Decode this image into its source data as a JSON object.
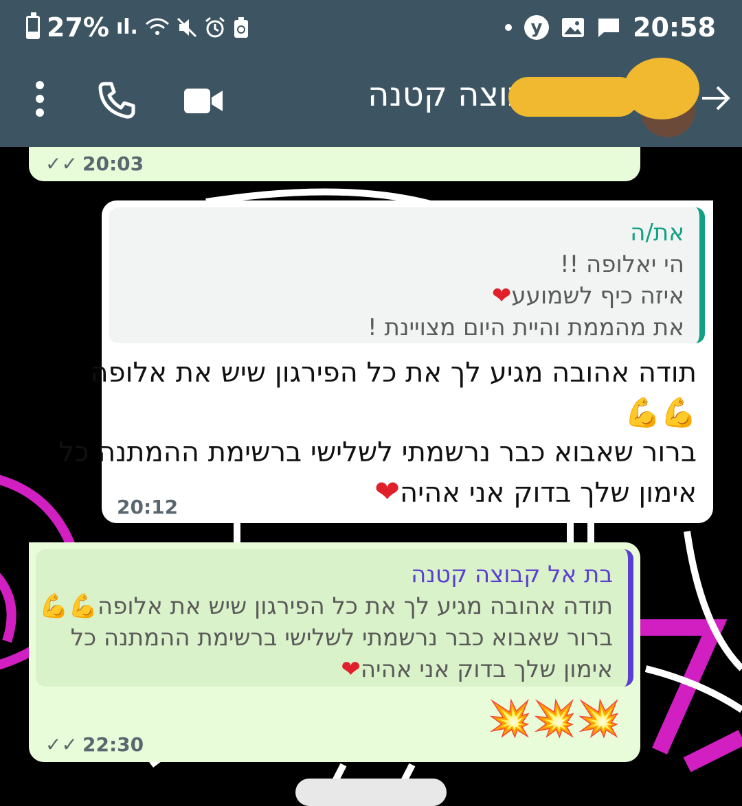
{
  "status_bar": {
    "battery": "27%",
    "clock": "20:58"
  },
  "header": {
    "title": "בת אל קבוצה קטנה"
  },
  "messages": {
    "prev_out": {
      "time": "20:03",
      "ticks": "✓✓"
    },
    "incoming": {
      "quote_name": "את/ה",
      "quote_lines": [
        "הי יאלופה !!",
        "איזה כיף לשמועע",
        "את מהממת והיית היום מצויינת !"
      ],
      "text_lines": [
        "תודה אהובה מגיע לך את כל הפירגון שיש את אלופה",
        "💪💪",
        "ברור שאבוא כבר נרשמתי לשלישי ברשימת ההמתנה כל",
        "אימון שלך בדוק אני אהיה"
      ],
      "time": "20:12"
    },
    "outgoing": {
      "quote_name": "בת אל קבוצה קטנה",
      "quote_lines": [
        "תודה אהובה מגיע לך את כל הפירגון שיש את אלופה",
        "ברור שאבוא כבר נרשמתי לשלישי ברשימת ההמתנה כל",
        "אימון שלך בדוק אני אהיה"
      ],
      "emoji": "💥💥💥",
      "time": "22:30",
      "ticks": "✓✓"
    }
  },
  "colors": {
    "header_bg": "#3d5563",
    "out_bubble": "#e8fcd9",
    "in_bubble": "#ffffff",
    "quote_in_accent": "#12a085",
    "quote_out_accent": "#5a3fd1"
  },
  "icons": [
    "battery-icon",
    "signal-icon",
    "wifi-icon",
    "mute-icon",
    "alarm-icon",
    "recycle-battery-icon",
    "notification-dot-icon",
    "y-app-icon",
    "gallery-icon",
    "message-icon",
    "menu-icon",
    "phone-icon",
    "video-icon",
    "avatar",
    "back-arrow-icon",
    "heart-icon",
    "muscle-icon",
    "collision-icon",
    "double-check-icon"
  ]
}
